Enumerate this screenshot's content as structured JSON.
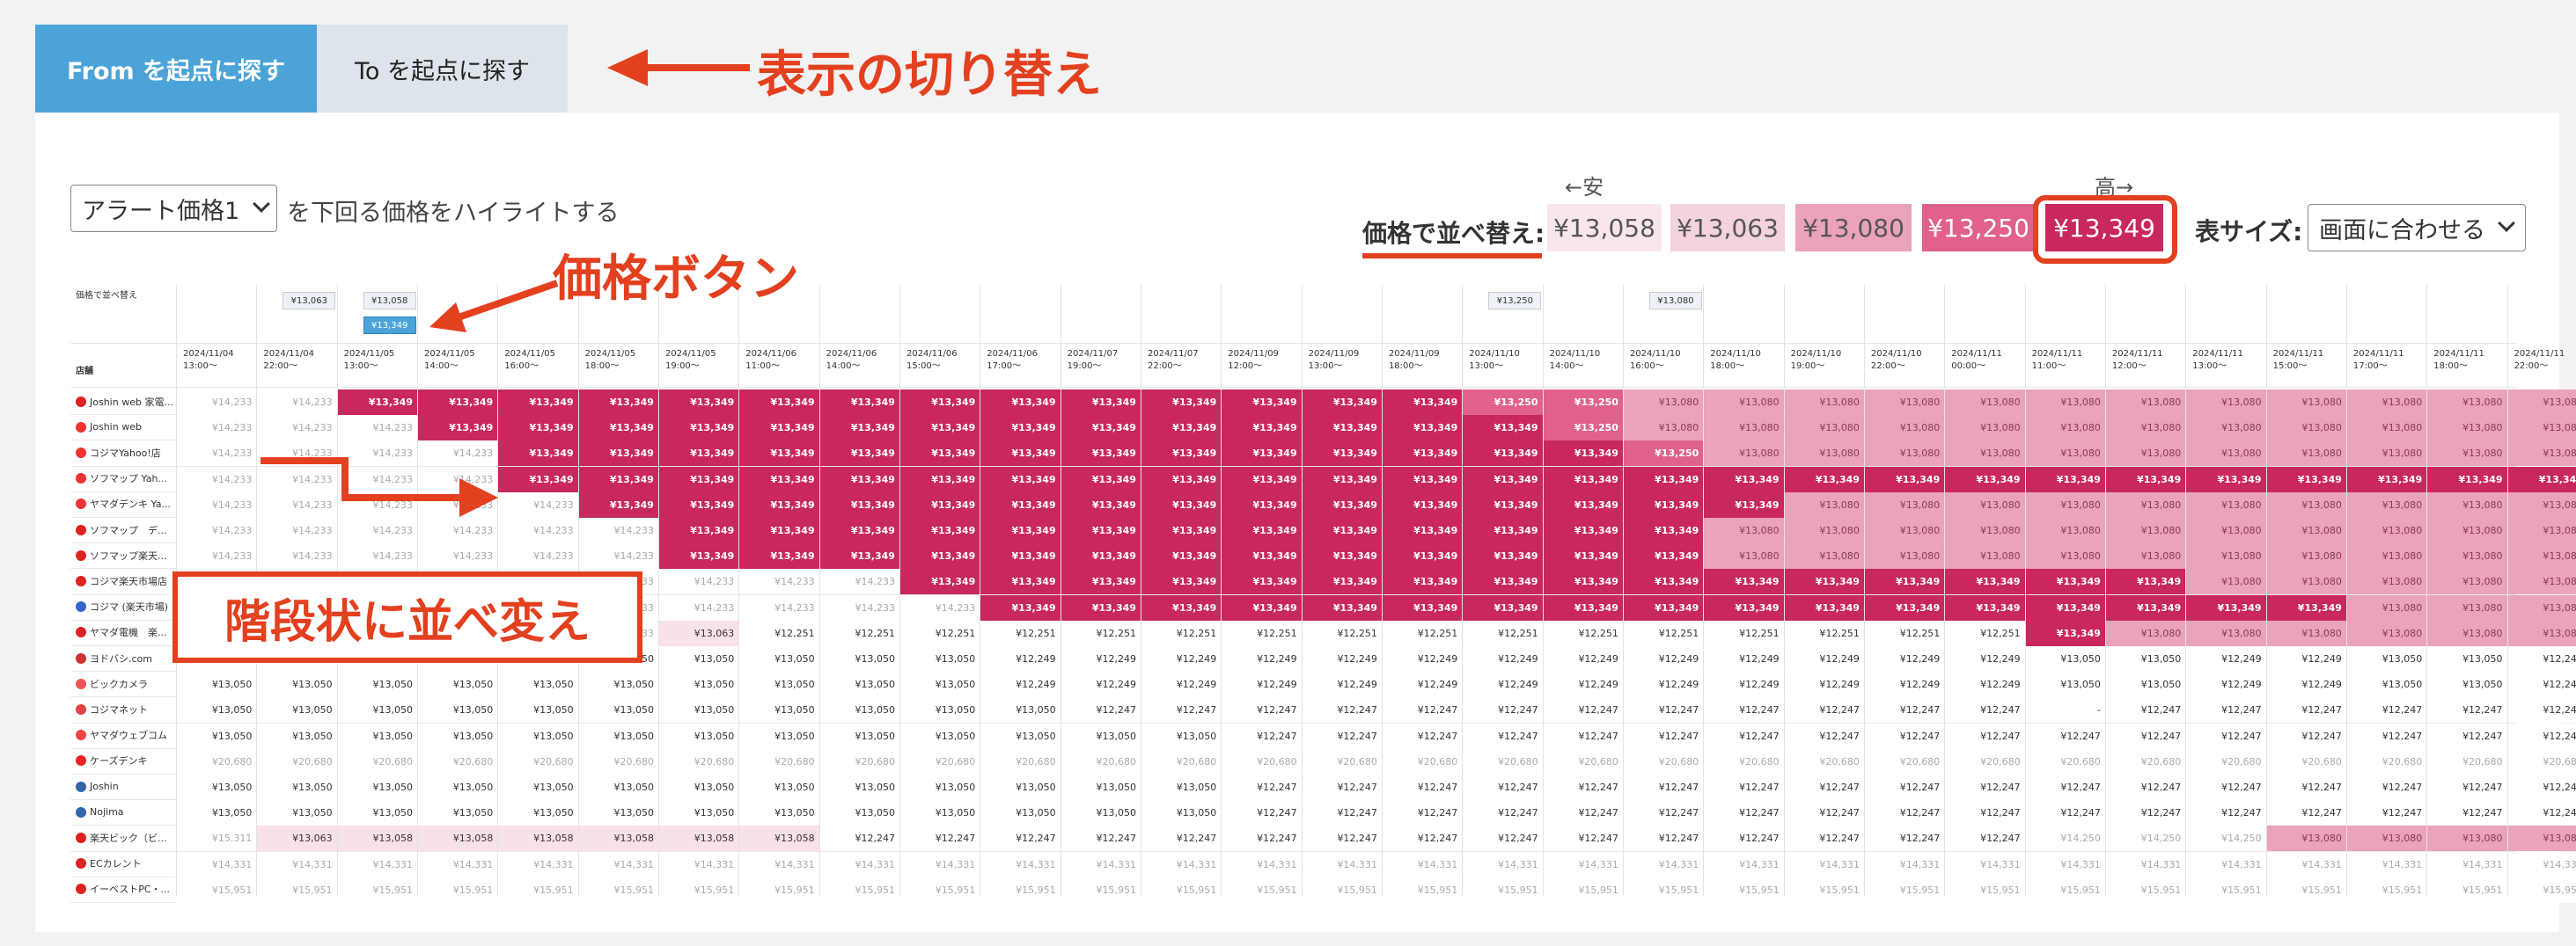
{
  "tabs": [
    {
      "label": "From を起点に探す"
    },
    {
      "label": "To を起点に探す"
    }
  ],
  "annotations": {
    "toggle": "表示の切り替え",
    "price_button": "価格ボタン",
    "staircase": "階段状に並べ変え"
  },
  "alert": {
    "select_value": "アラート価格1",
    "text": "を下回る価格をハイライトする"
  },
  "sort": {
    "label": "価格で並べ替え:",
    "low_label": "←安",
    "high_label": "高→",
    "buttons": [
      {
        "price": "¥13,058",
        "color": "#f8e6ea"
      },
      {
        "price": "¥13,063",
        "color": "#f3d3dc"
      },
      {
        "price": "¥13,080",
        "color": "#eaa3b9"
      },
      {
        "price": "¥13,250",
        "color": "#e0628c"
      },
      {
        "price": "¥13,349",
        "color": "#c8285c"
      }
    ]
  },
  "table_size": {
    "label": "表サイズ:",
    "value": "画面に合わせる"
  },
  "table": {
    "sort_header": "価格で並べ替え",
    "store_header": "店舗",
    "price_buttons": [
      {
        "col": 1,
        "price": "¥13,063"
      },
      {
        "col": 2,
        "price": "¥13,058"
      },
      {
        "col": 2,
        "price": "¥13,349",
        "active": true
      },
      {
        "col": 16,
        "price": "¥13,250"
      },
      {
        "col": 18,
        "price": "¥13,080"
      }
    ],
    "columns": [
      [
        "2024/11/04",
        "13:00〜"
      ],
      [
        "2024/11/04",
        "22:00〜"
      ],
      [
        "2024/11/05",
        "13:00〜"
      ],
      [
        "2024/11/05",
        "14:00〜"
      ],
      [
        "2024/11/05",
        "16:00〜"
      ],
      [
        "2024/11/05",
        "18:00〜"
      ],
      [
        "2024/11/05",
        "19:00〜"
      ],
      [
        "2024/11/06",
        "11:00〜"
      ],
      [
        "2024/11/06",
        "14:00〜"
      ],
      [
        "2024/11/06",
        "15:00〜"
      ],
      [
        "2024/11/06",
        "17:00〜"
      ],
      [
        "2024/11/07",
        "19:00〜"
      ],
      [
        "2024/11/07",
        "22:00〜"
      ],
      [
        "2024/11/09",
        "12:00〜"
      ],
      [
        "2024/11/09",
        "13:00〜"
      ],
      [
        "2024/11/09",
        "18:00〜"
      ],
      [
        "2024/11/10",
        "13:00〜"
      ],
      [
        "2024/11/10",
        "14:00〜"
      ],
      [
        "2024/11/10",
        "16:00〜"
      ],
      [
        "2024/11/10",
        "18:00〜"
      ],
      [
        "2024/11/10",
        "19:00〜"
      ],
      [
        "2024/11/10",
        "22:00〜"
      ],
      [
        "2024/11/11",
        "00:00〜"
      ],
      [
        "2024/11/11",
        "11:00〜"
      ],
      [
        "2024/11/11",
        "12:00〜"
      ],
      [
        "2024/11/11",
        "13:00〜"
      ],
      [
        "2024/11/11",
        "15:00〜"
      ],
      [
        "2024/11/11",
        "17:00〜"
      ],
      [
        "2024/11/11",
        "18:00〜"
      ],
      [
        "2024/11/11",
        "22:00〜"
      ]
    ],
    "stores": [
      {
        "name": "Joshin web 家電...",
        "icon": "#d22",
        "sym": "R"
      },
      {
        "name": "Joshin web",
        "icon": "#e33",
        "sym": "Y"
      },
      {
        "name": "コジマYahoo!店",
        "icon": "#e33",
        "sym": "Y"
      },
      {
        "name": "ソフマップ Yah...",
        "icon": "#e33",
        "sym": "Y"
      },
      {
        "name": "ヤマダデンキ Ya...",
        "icon": "#e33",
        "sym": "Y"
      },
      {
        "name": "ソフマップ　デ...",
        "icon": "#d22",
        "sym": "R"
      },
      {
        "name": "ソフマップ楽天...",
        "icon": "#d22",
        "sym": "R"
      },
      {
        "name": "コジマ楽天市場店",
        "icon": "#d22",
        "sym": "R"
      },
      {
        "name": "コジマ (楽天市場)",
        "icon": "#36c",
        "sym": "K"
      },
      {
        "name": "ヤマダ電機　楽...",
        "icon": "#d22",
        "sym": "R"
      },
      {
        "name": "ヨドバシ.com",
        "icon": "#c33",
        "sym": "Y"
      },
      {
        "name": "ビックカメラ",
        "icon": "#e55",
        "sym": "B"
      },
      {
        "name": "コジマネット",
        "icon": "#d44",
        "sym": "K"
      },
      {
        "name": "ヤマダウェブコム",
        "icon": "#e44",
        "sym": "Y"
      },
      {
        "name": "ケーズデンキ",
        "icon": "#e22",
        "sym": "K"
      },
      {
        "name": "Joshin",
        "icon": "#36a",
        "sym": "J"
      },
      {
        "name": "Nojima",
        "icon": "#36a",
        "sym": "N"
      },
      {
        "name": "楽天ビック（ビ...",
        "icon": "#d22",
        "sym": "R"
      },
      {
        "name": "ECカレント",
        "icon": "#d22",
        "sym": "R"
      },
      {
        "name": "イーベストPC・...",
        "icon": "#d22",
        "sym": "R"
      }
    ],
    "rows": [
      "G14233 G14233 P0 P0 P0 P0 P0 P0 P0 P0 P0 P0 P0 P0 P0 P0 P1 P1 P2 P2 P2 P2 P2 P2 P2 P2 P2 P2 P2 P2",
      "G14233 G14233 G14233 P0 P0 P0 P0 P0 P0 P0 P0 P0 P0 P0 P0 P0 P0 P1 P2 P2 P2 P2 P2 P2 P2 P2 P2 P2 P2 P2",
      "G14233 G14233 G14233 G14233 P0 P0 P0 P0 P0 P0 P0 P0 P0 P0 P0 P0 P0 P0 P1 P2 P2 P2 P2 P2 P2 P2 P2 P2 P2 P2",
      "G14233 G14233 G14233 G14233 P0 P0 P0 P0 P0 P0 P0 P0 P0 P0 P0 P0 P0 P0 P0 P0 P0 P0 P0 P0 P0 P0 P0 P0 P0 P0",
      "G14233 G14233 G14233 G14233 G14233 P0 P0 P0 P0 P0 P0 P0 P0 P0 P0 P0 P0 P0 P0 P0 P2 P2 P2 P2 P2 P2 P2 P2 P2 P2",
      "G14233 G14233 G14233 G14233 G14233 G14233 P0 P0 P0 P0 P0 P0 P0 P0 P0 P0 P0 P0 P0 P2 P2 P2 P2 P2 P2 P2 P2 P2 P2 P2",
      "G14233 G14233 G14233 G14233 G14233 G14233 P0 P0 P0 P0 P0 P0 P0 P0 P0 P0 P0 P0 P0 P2 P2 P2 P2 P2 P2 P2 P2 P2 P2 P2",
      "G14233 G14233 G14233 G14233 G14233 G14233 G14233 G14233 G14233 P0 P0 P0 P0 P0 P0 P0 P0 P0 P0 P0 P0 P0 P0 P0 P0 P2 P2 P2 P2 P2",
      "G14233 G14233 G14233 G14233 G14233 G14233 G14233 G14233 G14233 G14233 P0 P0 P0 P0 P0 P0 P0 P0 P0 P0 P0 P0 P0 P0 P0 P0 P0 P2 P2 P2",
      "G14233 G14233 G14233 G14233 G14233 G14233 T13063 N12251 N12251 N12251 N12251 N12251 N12251 N12251 N12251 N12251 N12251 N12251 N12251 N12251 N12251 N12251 N12251 P0 P2 P2 P2 P2 P2 P2",
      "N13050 N13050 N13050 N13050 N13050 N13050 N13050 N13050 N13050 N13050 N12249 N12249 N12249 N12249 N12249 N12249 N12249 N12249 N12249 N12249 N12249 N12249 N12249 N13050 N13050 N12249 N12249 N13050 N13050 N12240",
      "N13050 N13050 N13050 N13050 N13050 N13050 N13050 N13050 N13050 N13050 N12249 N12249 N12249 N12249 N12249 N12249 N12249 N12249 N12249 N12249 N12249 N12249 N12249 N13050 N13050 N12249 N12249 N13050 N13050 N12240",
      "N13050 N13050 N13050 N13050 N13050 N13050 N13050 N13050 N13050 N13050 N13050 N12247 N12247 N12247 N12247 N12247 N12247 N12247 N12247 N12247 N12247 N12247 N12247 - N12247 N12247 N12247 N12247 N12247 N12247",
      "N13050 N13050 N13050 N13050 N13050 N13050 N13050 N13050 N13050 N13050 N13050 N13050 N13050 N12247 N12247 N12247 N12247 N12247 N12247 N12247 N12247 N12247 N12247 N12247 N12247 N12247 N12247 N12247 N12247 N12247",
      "G20680 G20680 G20680 G20680 G20680 G20680 G20680 G20680 G20680 G20680 G20680 G20680 G20680 G20680 G20680 G20680 G20680 G20680 G20680 G20680 G20680 G20680 G20680 G20680 G20680 G20680 G20680 G20680 G20680 G20680",
      "N13050 N13050 N13050 N13050 N13050 N13050 N13050 N13050 N13050 N13050 N13050 N13050 N13050 N12247 N12247 N12247 N12247 N12247 N12247 N12247 N12247 N12247 N12247 N12247 N12247 N12247 N12247 N12247 N12247 N12247",
      "N13050 N13050 N13050 N13050 N13050 N13050 N13050 N13050 N13050 N13050 N13050 N13050 N13050 N12247 N12247 N12247 N12247 N12247 N12247 N12247 N12247 N12247 N12247 N12247 N12247 N12247 N12247 N12247 N12247 N12247",
      "G15311 T13063 T13058 T13058 T13058 T13058 T13058 T13058 N12247 N12247 N12247 N12247 N12247 N12247 N12247 N12247 N12247 N12247 N12247 N12247 N12247 N12247 N12247 G14250 G14250 G14250 P2 P2 P2 P2",
      "G14331 G14331 G14331 G14331 G14331 G14331 G14331 G14331 G14331 G14331 G14331 G14331 G14331 G14331 G14331 G14331 G14331 G14331 G14331 G14331 G14331 G14331 G14331 G14331 G14331 G14331 G14331 G14331 G14331 G14331",
      "G15951 G15951 G15951 G15951 G15951 G15951 G15951 G15951 G15951 G15951 G15951 G15951 G15951 G15951 G15951 G15951 G15951 G15951 G15951 G15951 G15951 G15951 G15951 G15951 G15951 G15951 G15951 G15951 G15951 G15951"
    ],
    "price_map": {
      "P0": "¥13,349",
      "P1": "¥13,250",
      "P2": "¥13,080"
    },
    "cell_colors": {
      "P0": "#c8285c",
      "P1": "#e0628c",
      "P2": "#eaa3b9",
      "T": "#f8e1e7",
      "N": "#ffffff",
      "G": "#ffffff"
    }
  }
}
